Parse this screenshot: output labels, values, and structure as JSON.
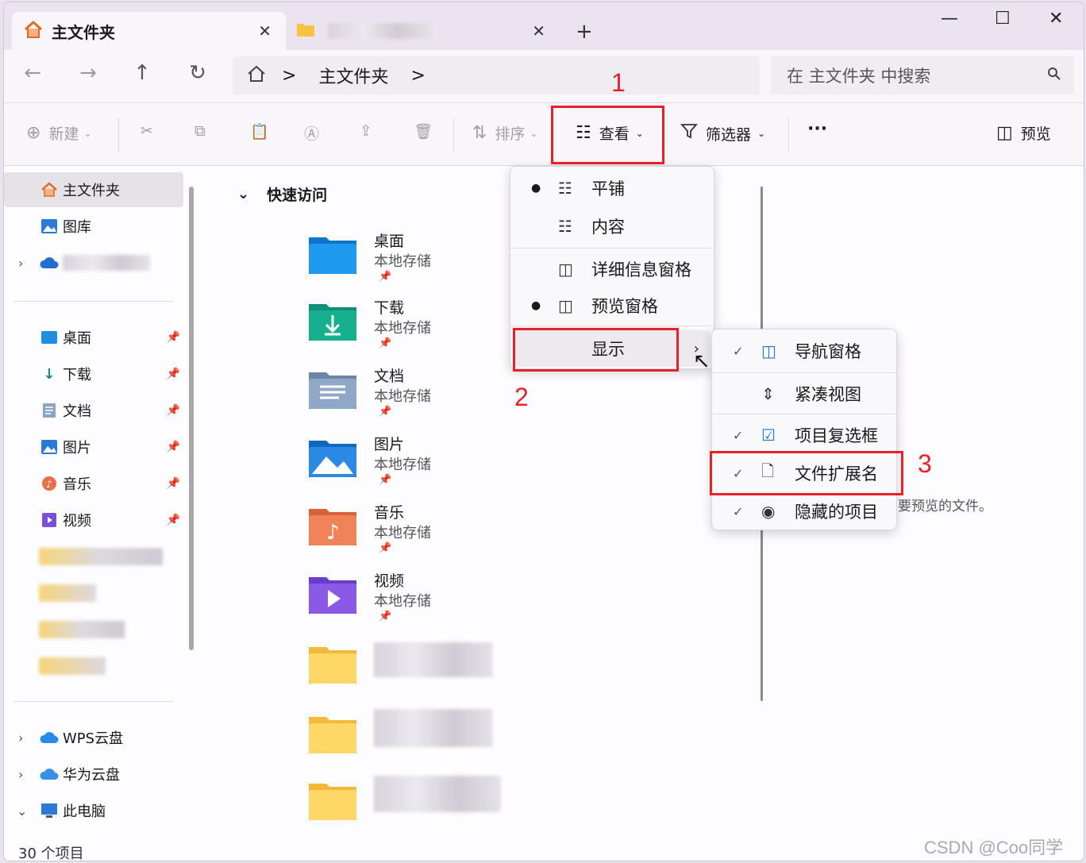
{
  "tabs": {
    "active_title": "主文件夹",
    "close_glyph": "✕",
    "new_tab_glyph": "+"
  },
  "window_controls": {
    "minimize": "—",
    "maximize": "☐",
    "close": "✕"
  },
  "address": {
    "crumb": "主文件夹",
    "separator": ">"
  },
  "search": {
    "placeholder": "在 主文件夹 中搜索"
  },
  "toolbar": {
    "new_label": "新建",
    "sort_label": "排序",
    "view_label": "查看",
    "filter_label": "筛选器",
    "more_label": "···",
    "preview_label": "预览"
  },
  "sidebar": {
    "home": "主文件夹",
    "gallery": "图库",
    "pinned": [
      "桌面",
      "下载",
      "文档",
      "图片",
      "音乐",
      "视频"
    ],
    "wps": "WPS云盘",
    "huawei": "华为云盘",
    "thispc": "此电脑"
  },
  "main": {
    "quick_access": "快速访问",
    "local_storage": "本地存储",
    "folders": [
      "桌面",
      "下载",
      "文档",
      "图片",
      "音乐",
      "视频"
    ]
  },
  "view_menu": {
    "items": [
      "平铺",
      "内容",
      "详细信息窗格",
      "预览窗格",
      "显示"
    ]
  },
  "show_menu": {
    "items": [
      "导航窗格",
      "紧凑视图",
      "项目复选框",
      "文件扩展名",
      "隐藏的项目"
    ]
  },
  "preview_hint": "要预览的文件。",
  "status": "30 个项目",
  "annotations": [
    "1",
    "2",
    "3"
  ],
  "watermark": "CSDN @Coo同学",
  "colors": {
    "highlight": "#e8202a",
    "accent": "#1e78d4"
  }
}
